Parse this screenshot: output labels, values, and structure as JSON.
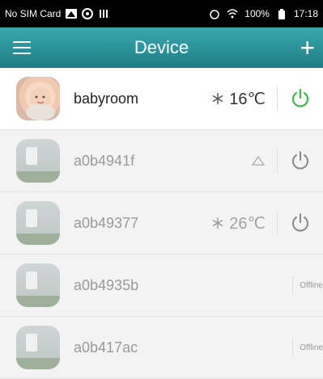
{
  "status_bar": {
    "carrier": "No SIM Card",
    "battery": "100%",
    "time": "17:18"
  },
  "header": {
    "title": "Device",
    "add_label": "+"
  },
  "devices": [
    {
      "name": "babyroom",
      "temperature": "16℃",
      "mode_icon": "snowflake-icon",
      "power_color": "#3bb84a",
      "status": ""
    },
    {
      "name": "a0b4941f",
      "temperature": "",
      "mode_icon": "triangle-icon",
      "power_color": "#888888",
      "status": ""
    },
    {
      "name": "a0b49377",
      "temperature": "26℃",
      "mode_icon": "snowflake-icon",
      "power_color": "#888888",
      "status": ""
    },
    {
      "name": "a0b4935b",
      "temperature": "",
      "mode_icon": "",
      "power_color": "",
      "status": "Offline"
    },
    {
      "name": "a0b417ac",
      "temperature": "",
      "mode_icon": "",
      "power_color": "",
      "status": "Offline"
    }
  ],
  "colors": {
    "header_bg": "#2a9199",
    "active_power": "#3bb84a"
  }
}
